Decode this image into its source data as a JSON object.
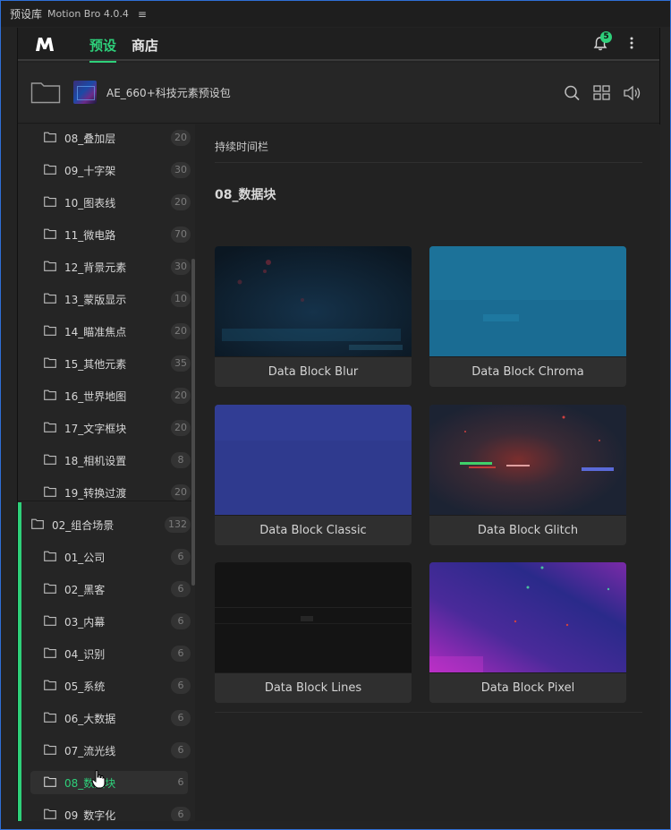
{
  "window": {
    "app_name": "预设库",
    "version": "Motion Bro 4.0.4",
    "menu_icon": "hamburger-icon"
  },
  "topnav": {
    "tabs": [
      {
        "label": "预设",
        "active": true
      },
      {
        "label": "商店",
        "active": false
      }
    ],
    "notification_count": "5",
    "accent_color": "#2ed07a"
  },
  "package": {
    "title": "AE_660+科技元素预设包",
    "tools": [
      "search-icon",
      "grid-view-icon",
      "volume-icon"
    ]
  },
  "sidebar": {
    "items": [
      {
        "label": "08_叠加层",
        "count": "20",
        "level": 2
      },
      {
        "label": "09_十字架",
        "count": "30",
        "level": 2
      },
      {
        "label": "10_图表线",
        "count": "20",
        "level": 2
      },
      {
        "label": "11_微电路",
        "count": "70",
        "level": 2
      },
      {
        "label": "12_背景元素",
        "count": "30",
        "level": 2
      },
      {
        "label": "13_蒙版显示",
        "count": "10",
        "level": 2
      },
      {
        "label": "14_瞄准焦点",
        "count": "20",
        "level": 2
      },
      {
        "label": "15_其他元素",
        "count": "35",
        "level": 2
      },
      {
        "label": "16_世界地图",
        "count": "20",
        "level": 2
      },
      {
        "label": "17_文字框块",
        "count": "20",
        "level": 2
      },
      {
        "label": "18_相机设置",
        "count": "8",
        "level": 2
      },
      {
        "label": "19_转换过渡",
        "count": "20",
        "level": 2
      },
      {
        "label": "02_组合场景",
        "count": "132",
        "level": 1
      },
      {
        "label": "01_公司",
        "count": "6",
        "level": 2
      },
      {
        "label": "02_黑客",
        "count": "6",
        "level": 2
      },
      {
        "label": "03_内幕",
        "count": "6",
        "level": 2
      },
      {
        "label": "04_识别",
        "count": "6",
        "level": 2
      },
      {
        "label": "05_系统",
        "count": "6",
        "level": 2
      },
      {
        "label": "06_大数据",
        "count": "6",
        "level": 2
      },
      {
        "label": "07_流光线",
        "count": "6",
        "level": 2
      },
      {
        "label": "08_数据块",
        "count": "6",
        "level": 2,
        "selected": true
      },
      {
        "label": "09_数字化",
        "count": "6",
        "level": 2
      }
    ]
  },
  "content": {
    "duration_label": "持续时间栏",
    "section_title": "08_数据块",
    "cards": [
      {
        "label": "Data Block Blur"
      },
      {
        "label": "Data Block Chroma"
      },
      {
        "label": "Data Block Classic"
      },
      {
        "label": "Data Block Glitch"
      },
      {
        "label": "Data Block Lines"
      },
      {
        "label": "Data Block Pixel"
      }
    ]
  }
}
